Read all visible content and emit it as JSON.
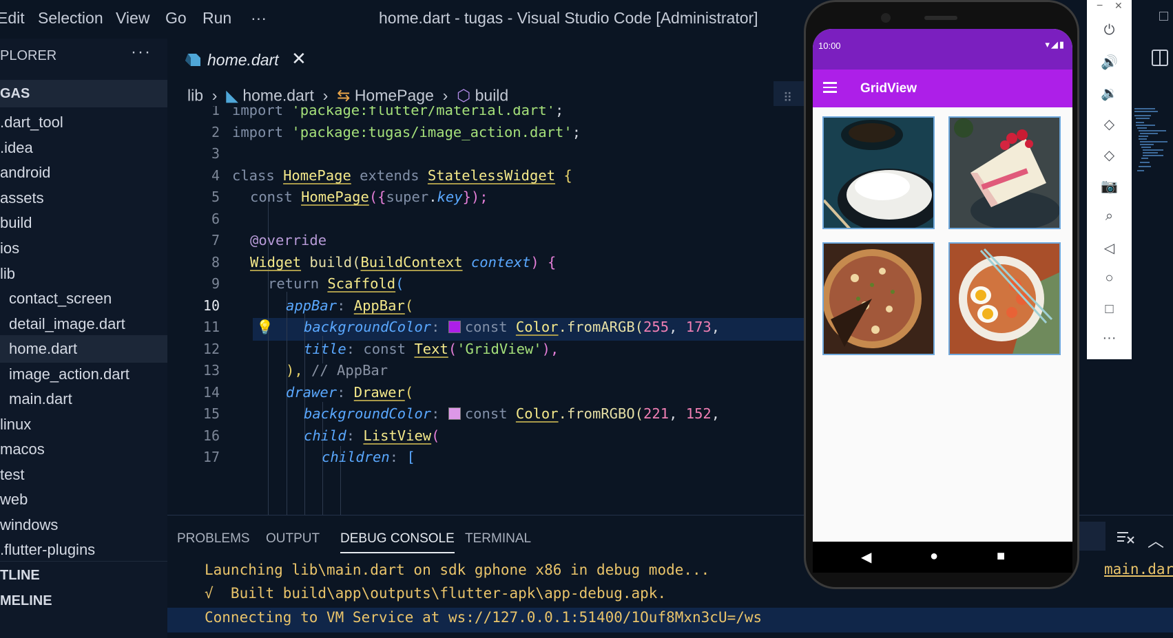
{
  "window": {
    "title": "home.dart - tugas - Visual Studio Code [Administrator]",
    "menu": [
      "Edit",
      "Selection",
      "View",
      "Go",
      "Run",
      "···"
    ]
  },
  "sidebar": {
    "header": "PLORER",
    "more": "···",
    "folder": "GAS",
    "items": [
      {
        "label": ".dart_tool"
      },
      {
        "label": ".idea"
      },
      {
        "label": "android"
      },
      {
        "label": "assets"
      },
      {
        "label": "build"
      },
      {
        "label": "ios"
      },
      {
        "label": "lib"
      },
      {
        "label": "contact_screen"
      },
      {
        "label": "detail_image.dart"
      },
      {
        "label": "home.dart",
        "active": true
      },
      {
        "label": "image_action.dart"
      },
      {
        "label": "main.dart"
      },
      {
        "label": "linux"
      },
      {
        "label": "macos"
      },
      {
        "label": "test"
      },
      {
        "label": "web"
      },
      {
        "label": "windows"
      },
      {
        "label": ".flutter-plugins"
      }
    ],
    "outline": "TLINE",
    "timeline": "MELINE"
  },
  "editor": {
    "tab": {
      "label": "home.dart",
      "close": "✕"
    },
    "breadcrumb": {
      "root": "lib",
      "file": "home.dart",
      "class": "HomePage",
      "method": "build"
    },
    "line_numbers": [
      "1",
      "2",
      "3",
      "4",
      "5",
      "6",
      "7",
      "8",
      "9",
      "10",
      "11",
      "12",
      "13",
      "14",
      "15",
      "16",
      "17"
    ],
    "current_line": "10",
    "code": {
      "l1a": "import ",
      "l1b": "'package:flutter/material.dart'",
      "l1c": ";",
      "l2a": "import ",
      "l2b": "'package:tugas/image_action.dart'",
      "l2c": ";",
      "l4a": "class ",
      "l4b": "HomePage",
      "l4c": " extends ",
      "l4d": "StatelessWidget",
      "l4e": " {",
      "l5a": "const ",
      "l5b": "HomePage",
      "l5c": "({",
      "l5d": "super",
      "l5e": ".",
      "l5f": "key",
      "l5g": "});",
      "l7": "@override",
      "l8a": "Widget",
      "l8b": " build(",
      "l8c": "BuildContext",
      "l8d": " context",
      "l8e": ") {",
      "l9a": "return ",
      "l9b": "Scaffold",
      "l9c": "(",
      "l10a": "appBar",
      "l10b": ": ",
      "l10c": "AppBar",
      "l10d": "(",
      "l11a": "backgroundColor",
      "l11b": ": ",
      "l11c": "const ",
      "l11d": "Color",
      "l11e": ".fromARGB(",
      "l11f": "255",
      "l11g": ", ",
      "l11h": "173",
      "l11i": ",",
      "l12a": "title",
      "l12b": ": ",
      "l12c": "const ",
      "l12d": "Text",
      "l12e": "(",
      "l12f": "'GridView'",
      "l12g": "),",
      "l13a": "),",
      "l13b": " // AppBar",
      "l14a": "drawer",
      "l14b": ": ",
      "l14c": "Drawer",
      "l14d": "(",
      "l15a": "backgroundColor",
      "l15b": ": ",
      "l15c": "const ",
      "l15d": "Color",
      "l15e": ".fromRGBO(",
      "l15f": "221",
      "l15g": ", ",
      "l15h": "152",
      "l15i": ",",
      "l16a": "child",
      "l16b": ": ",
      "l16c": "ListView",
      "l16d": "(",
      "l17a": "children",
      "l17b": ": ",
      "l17c": "["
    },
    "swatch_colors": {
      "appbar": "#ad1fe8",
      "drawer": "#dd98e8"
    }
  },
  "panel": {
    "tabs": [
      {
        "label": "PROBLEMS"
      },
      {
        "label": "OUTPUT"
      },
      {
        "label": "DEBUG CONSOLE",
        "active": true
      },
      {
        "label": "TERMINAL"
      }
    ],
    "output": [
      "Launching lib\\main.dart on sdk gphone x86 in debug mode...",
      "√  Built build\\app\\outputs\\flutter-apk\\app-debug.apk.",
      "Connecting to VM Service at ws://127.0.0.1:51400/1Ouf8Mxn3cU=/ws"
    ],
    "link": "main.dar"
  },
  "emulator": {
    "status_time": "10:00",
    "appbar_title": "GridView",
    "colors": {
      "status": "#7b1fbf",
      "appbar": "#ad1fe8"
    },
    "tiles": [
      {
        "alt": "rice-bowl"
      },
      {
        "alt": "strawberry-cake"
      },
      {
        "alt": "pizza"
      },
      {
        "alt": "ramen-bowl"
      }
    ],
    "controls": [
      "power-icon",
      "volume-up-icon",
      "volume-down-icon",
      "rotate-left-icon",
      "rotate-right-icon",
      "camera-icon",
      "zoom-icon",
      "back-icon",
      "home-icon",
      "overview-icon",
      "more-icon"
    ],
    "window_buttons": [
      "−",
      "✕"
    ]
  }
}
